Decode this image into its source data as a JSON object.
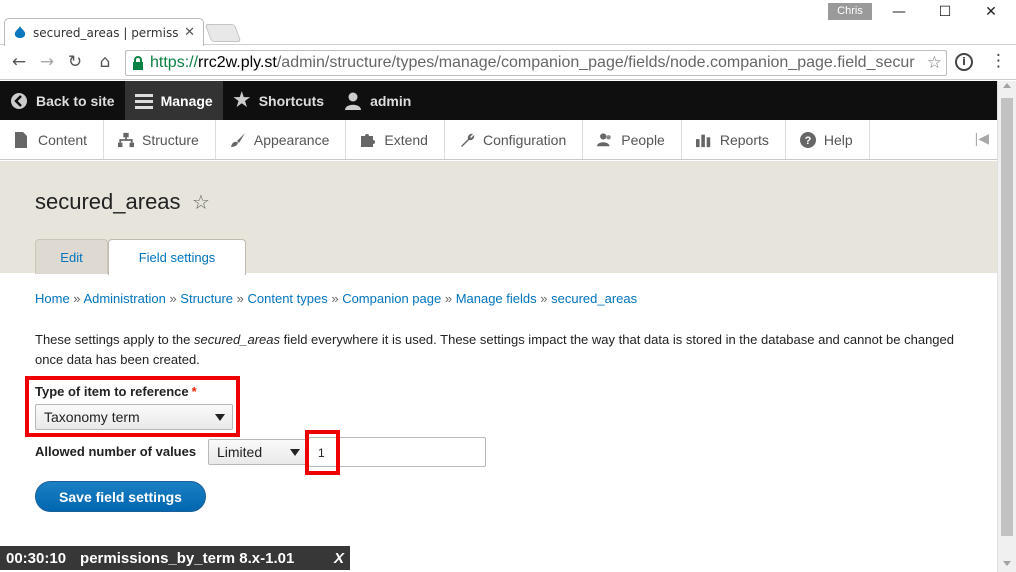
{
  "browser": {
    "tab_title": "secured_areas | permissio",
    "profile_name": "Chris",
    "url_scheme": "https://",
    "url_host": "rrc2w.ply.st",
    "url_path": "/admin/structure/types/manage/companion_page/fields/node.companion_page.field_secur"
  },
  "admin_toolbar": {
    "items": [
      {
        "label": "Back to site",
        "icon": "chevron-left-circle-icon"
      },
      {
        "label": "Manage",
        "icon": "hamburger-icon"
      },
      {
        "label": "Shortcuts",
        "icon": "star-icon"
      },
      {
        "label": "admin",
        "icon": "user-icon"
      }
    ]
  },
  "admin_tray": {
    "items": [
      {
        "label": "Content",
        "icon": "file-icon"
      },
      {
        "label": "Structure",
        "icon": "sitemap-icon"
      },
      {
        "label": "Appearance",
        "icon": "paintbrush-icon"
      },
      {
        "label": "Extend",
        "icon": "puzzle-icon"
      },
      {
        "label": "Configuration",
        "icon": "wrench-icon"
      },
      {
        "label": "People",
        "icon": "people-icon"
      },
      {
        "label": "Reports",
        "icon": "bar-chart-icon"
      },
      {
        "label": "Help",
        "icon": "help-icon"
      }
    ]
  },
  "page": {
    "title": "secured_areas",
    "tabs": [
      "Edit",
      "Field settings"
    ],
    "breadcrumb": [
      "Home",
      "Administration",
      "Structure",
      "Content types",
      "Companion page",
      "Manage fields",
      "secured_areas"
    ],
    "description_pre": "These settings apply to the ",
    "description_em": "secured_areas",
    "description_post": " field everywhere it is used. These settings impact the way that data is stored in the database and cannot be changed once data has been created.",
    "type_label": "Type of item to reference",
    "required_marker": "*",
    "type_value": "Taxonomy term",
    "allowed_label": "Allowed number of values",
    "allowed_select": "Limited",
    "allowed_number": "1",
    "save_label": "Save field settings"
  },
  "overlay": {
    "time": "00:30:10",
    "text": "permissions_by_term 8.x-1.01",
    "close": "X"
  },
  "colors": {
    "link": "#0074bd",
    "highlight": "#ee0000",
    "button": "#0066b0"
  }
}
